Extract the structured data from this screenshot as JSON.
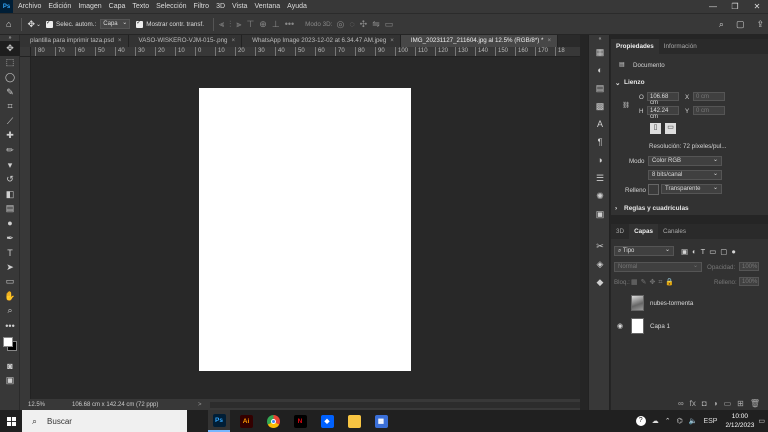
{
  "menu": {
    "logo": "Ps",
    "items": [
      "Archivo",
      "Edición",
      "Imagen",
      "Capa",
      "Texto",
      "Selección",
      "Filtro",
      "3D",
      "Vista",
      "Ventana",
      "Ayuda"
    ]
  },
  "options_bar": {
    "auto_select_label": "Selec. autom.:",
    "auto_select_value": "Capa",
    "transform_label": "Mostrar contr. transf.",
    "mode3d_label": "Modo 3D:"
  },
  "tabs": [
    {
      "label": "plantilla para imprimir taza.psd",
      "active": false
    },
    {
      "label": "VASO-WISKERO-VJM-015-.png",
      "active": false
    },
    {
      "label": "WhatsApp Image 2023-12-02 at 6.34.47 AM.jpeg",
      "active": false
    },
    {
      "label": "IMG_20231127_211604.jpg al 12.5% (RGB/8*) *",
      "active": true
    }
  ],
  "ruler": {
    "top_ticks": [
      "80",
      "70",
      "60",
      "50",
      "40",
      "30",
      "20",
      "10",
      "0",
      "10",
      "20",
      "30",
      "40",
      "50",
      "60",
      "70",
      "80",
      "90",
      "100",
      "110",
      "120",
      "130",
      "140",
      "150",
      "160",
      "170",
      "18"
    ]
  },
  "status": {
    "zoom": "12.5%",
    "size": "106.68 cm x 142.24 cm (72 ppp)",
    "arrow": ">"
  },
  "properties": {
    "tabs": [
      "Propiedades",
      "Información"
    ],
    "doc_label": "Documento",
    "section_canvas": "Lienzo",
    "w_label": "O",
    "w_value": "106.68 cm",
    "h_label": "H",
    "h_value": "142.24 cm",
    "x_label": "X",
    "x_value": "0 cm",
    "y_label": "Y",
    "y_value": "0 cm",
    "resolution": "Resolución: 72 píxeles/pul...",
    "mode_label": "Modo",
    "mode_value": "Color RGB",
    "bits_value": "8 bits/canal",
    "fill_label": "Relleno",
    "fill_value": "Transparente",
    "section_rules": "Reglas y cuadrículas"
  },
  "layers": {
    "tabs": [
      "3D",
      "Capas",
      "Canales"
    ],
    "filter_value": "Tipo",
    "blend_mode": "Normal",
    "opacity_label": "Opacidad:",
    "opacity_value": "100%",
    "lock_label": "Bloq.:",
    "fill_label": "Relleno:",
    "fill_value": "100%",
    "items": [
      {
        "name": "nubes-tormenta",
        "visible": false
      },
      {
        "name": "Capa 1",
        "visible": true
      }
    ]
  },
  "taskbar": {
    "search_placeholder": "Buscar",
    "lang": "ESP",
    "time": "10:00",
    "date": "2/12/2023",
    "apps": [
      {
        "name": "photoshop",
        "glyph": "Ps",
        "bg": "#001e36",
        "fg": "#31a8ff"
      },
      {
        "name": "illustrator",
        "glyph": "Ai",
        "bg": "#330000",
        "fg": "#ff9a00"
      },
      {
        "name": "chrome",
        "glyph": "",
        "bg": "#ffffff",
        "fg": "#000000"
      },
      {
        "name": "netflix",
        "glyph": "N",
        "bg": "#000000",
        "fg": "#e50914"
      },
      {
        "name": "dropbox",
        "glyph": "◆",
        "bg": "#0061fe",
        "fg": "#ffffff"
      },
      {
        "name": "file-explorer",
        "glyph": "",
        "bg": "#f8c542",
        "fg": "#000000"
      },
      {
        "name": "calculator",
        "glyph": "▦",
        "bg": "#3a6fd8",
        "fg": "#ffffff"
      }
    ]
  },
  "colors": {
    "accent": "#31a8ff",
    "ps_dark": "#001e36"
  }
}
